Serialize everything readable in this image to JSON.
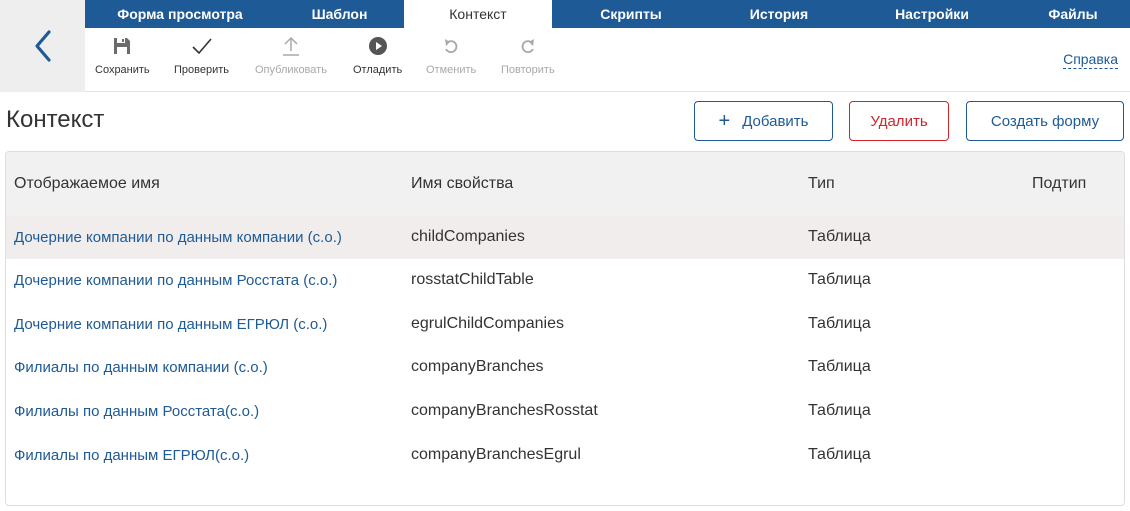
{
  "tabs": [
    {
      "label": "Форма просмотра"
    },
    {
      "label": "Шаблон"
    },
    {
      "label": "Контекст"
    },
    {
      "label": "Скрипты"
    },
    {
      "label": "История"
    },
    {
      "label": "Настройки"
    },
    {
      "label": "Файлы"
    }
  ],
  "active_tab": "Контекст",
  "toolbar": {
    "save": "Сохранить",
    "check": "Проверить",
    "publish": "Опубликовать",
    "debug": "Отладить",
    "undo": "Отменить",
    "redo": "Повторить",
    "help": "Справка"
  },
  "page": {
    "title": "Контекст",
    "add_button": "Добавить",
    "delete_button": "Удалить",
    "create_form_button": "Создать форму"
  },
  "table": {
    "headers": {
      "display_name": "Отображаемое имя",
      "property_name": "Имя свойства",
      "type": "Тип",
      "subtype": "Подтип"
    },
    "rows": [
      {
        "display_name": "Дочерние компании по данным компании (с.о.)",
        "property_name": "childCompanies",
        "type": "Таблица"
      },
      {
        "display_name": "Дочерние компании по данным Росстата (с.о.)",
        "property_name": "rosstatChildTable",
        "type": "Таблица"
      },
      {
        "display_name": "Дочерние компании по данным ЕГРЮЛ (с.о.)",
        "property_name": "egrulChildCompanies",
        "type": "Таблица"
      },
      {
        "display_name": "Филиалы по данным компании (с.о.)",
        "property_name": "companyBranches",
        "type": "Таблица"
      },
      {
        "display_name": "Филиалы по данным Росстата(с.о.)",
        "property_name": "companyBranchesRosstat",
        "type": "Таблица"
      },
      {
        "display_name": "Филиалы по данным ЕГРЮЛ(с.о.)",
        "property_name": "companyBranchesEgrul",
        "type": "Таблица"
      }
    ]
  },
  "colors": {
    "nav_blue": "#1e5a96",
    "link_blue": "#1e5a96",
    "danger_red": "#d0242b",
    "row_highlight": "#f1eded"
  },
  "icons": {
    "back": "chevron-left-icon",
    "save": "floppy-disk-icon",
    "check": "checkmark-icon",
    "publish": "upload-icon",
    "debug": "play-circle-icon",
    "undo": "undo-icon",
    "redo": "redo-icon",
    "add": "plus-icon"
  }
}
